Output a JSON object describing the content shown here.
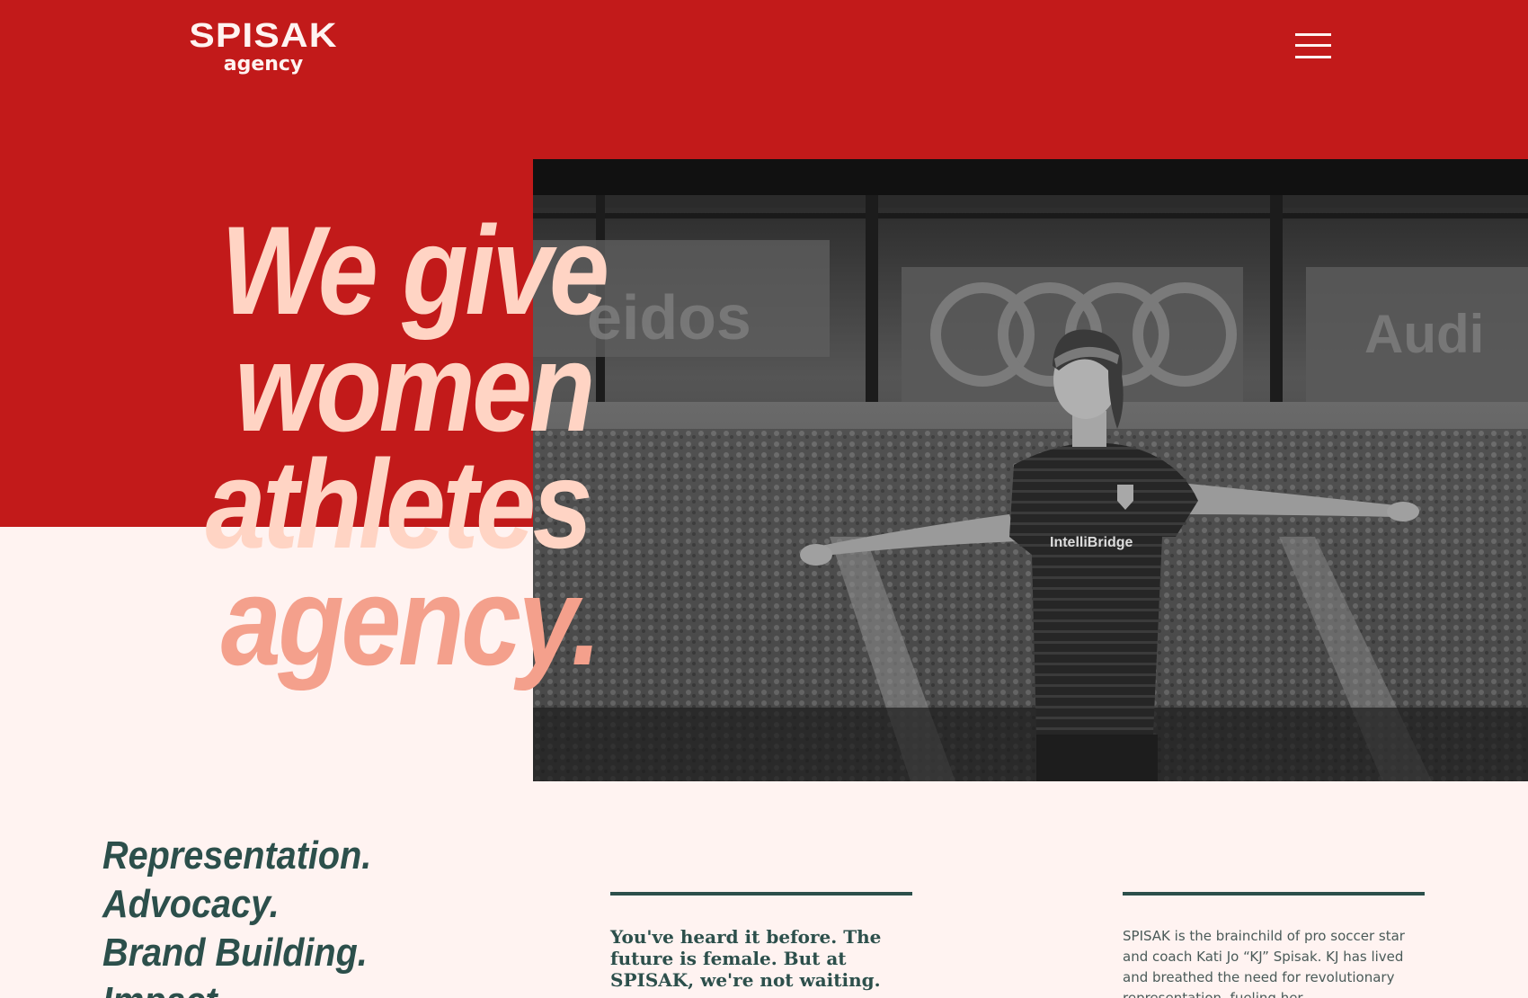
{
  "brand": {
    "logo_main": "SPISAK",
    "logo_sub": "agency"
  },
  "nav": {
    "menu_icon": "hamburger-menu-icon"
  },
  "hero": {
    "headline_lines": [
      "We give",
      "women",
      "athletes",
      "agency."
    ],
    "photo_icon": "soccer-player-photo"
  },
  "services": [
    "Representation.",
    "Advocacy.",
    "Brand Building.",
    "Impact."
  ],
  "intro": {
    "mid_text": "You've heard it before. The future is female. But at SPISAK, we're not waiting.",
    "right_text": "SPISAK is the brainchild of pro soccer star and coach Kati Jo “KJ” Spisak. KJ has lived and breathed the need for revolutionary representation, fueling her"
  },
  "colors": {
    "brand_red": "#c21a1a",
    "cream": "#fff3f1",
    "peach": "#ffd4c4",
    "salmon": "#f4a08c",
    "teal_dark": "#2c4f4b"
  }
}
